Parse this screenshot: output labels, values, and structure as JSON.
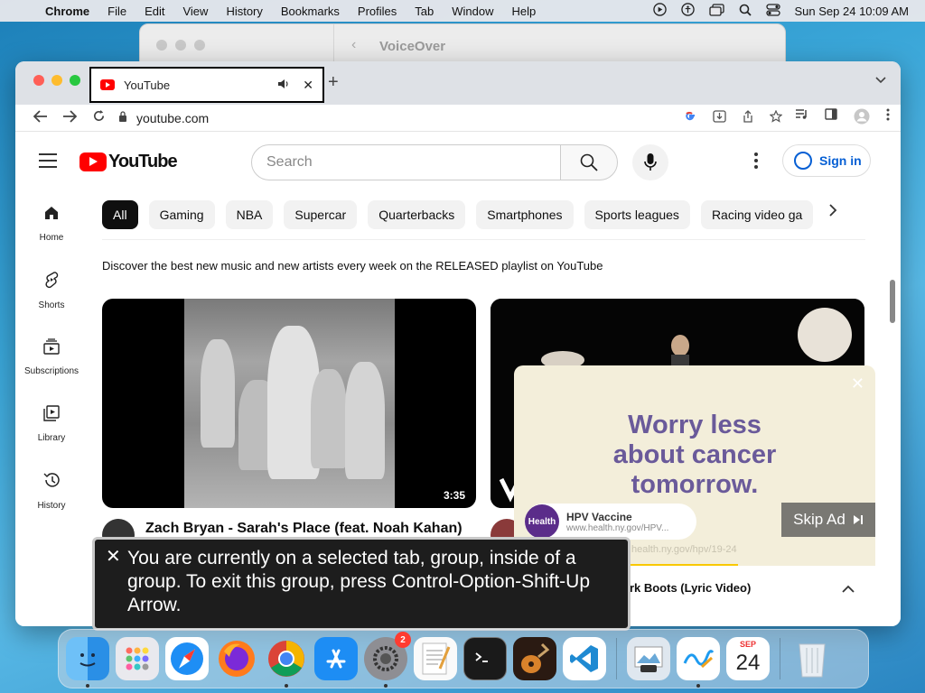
{
  "menubar": {
    "app": "Chrome",
    "items": [
      "File",
      "Edit",
      "View",
      "History",
      "Bookmarks",
      "Profiles",
      "Tab",
      "Window",
      "Help"
    ],
    "clock": "Sun Sep 24  10:09 AM"
  },
  "voiceover_window": {
    "title": "VoiceOver"
  },
  "browser": {
    "tab_title": "YouTube",
    "url": "youtube.com"
  },
  "youtube": {
    "logo_text": "YouTube",
    "search_placeholder": "Search",
    "sign_in": "Sign in",
    "guide": [
      {
        "label": "Home",
        "icon": "home-icon"
      },
      {
        "label": "Shorts",
        "icon": "shorts-icon"
      },
      {
        "label": "Subscriptions",
        "icon": "subscriptions-icon"
      },
      {
        "label": "Library",
        "icon": "library-icon"
      },
      {
        "label": "History",
        "icon": "history-icon"
      }
    ],
    "chips": [
      "All",
      "Gaming",
      "NBA",
      "Supercar",
      "Quarterbacks",
      "Smartphones",
      "Sports leagues",
      "Racing video ga"
    ],
    "promo_text": "Discover the best new music and new artists every week on the RELEASED playlist on YouTube",
    "video1": {
      "title": "Zach Bryan - Sarah's Place (feat. Noah Kahan)",
      "duration": "3:35"
    },
    "video2": {
      "title": "ork Boots (Lyric Video)"
    }
  },
  "ad": {
    "headline_line1": "Worry less",
    "headline_line2": "about cancer",
    "headline_line3": "tomorrow.",
    "advertiser_logo": "Health",
    "advertiser_name": "HPV Vaccine",
    "advertiser_url": "www.health.ny.gov/HPV...",
    "faint_url": "health.ny.gov/hpv/19-24",
    "skip_label": "Skip Ad",
    "progress": 0.62
  },
  "voiceover_caption": {
    "text": "You are currently on a selected tab, group, inside of a group.  To exit this group, press Control-Option-Shift-Up Arrow."
  },
  "dock": {
    "apps": [
      "finder",
      "launchpad",
      "safari",
      "firefox",
      "chrome",
      "app-store",
      "system-settings",
      "textedit",
      "terminal",
      "garageband",
      "vscode",
      "preview",
      "freeform",
      "calendar",
      "trash"
    ],
    "settings_badge": "2",
    "calendar_month": "SEP",
    "calendar_day": "24"
  }
}
